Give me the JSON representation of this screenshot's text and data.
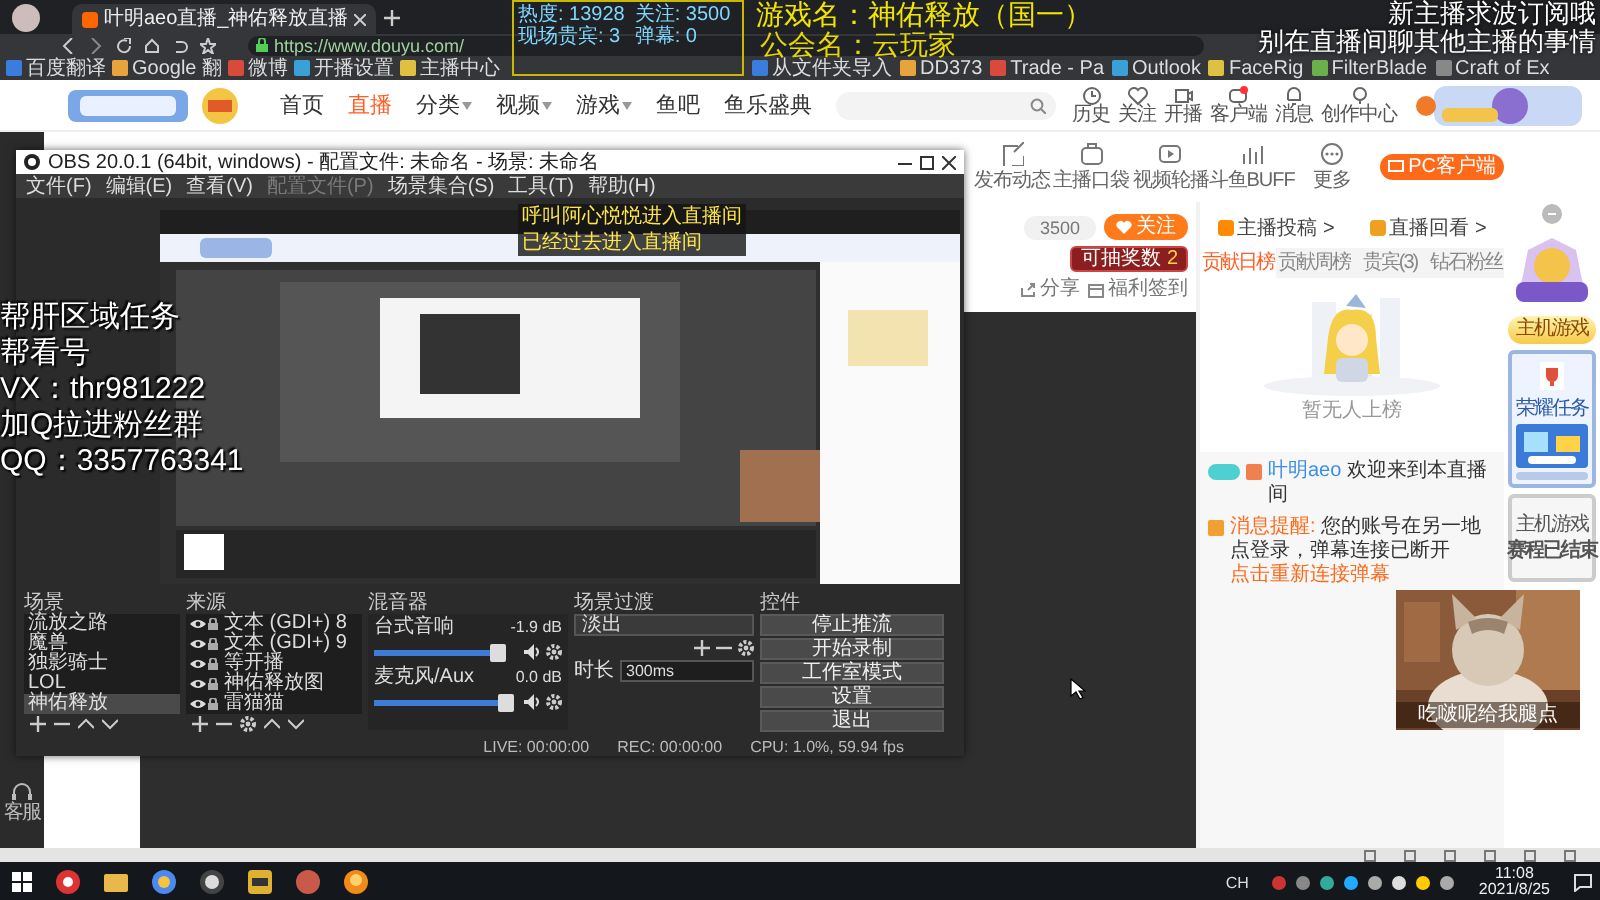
{
  "browser": {
    "tab_title": "叶明aeo直播_神佑释放直播",
    "address": "https://www.douyu.com/",
    "bookmarks_left": [
      "百度翻译",
      "Google 翻",
      "微博",
      "开播设置",
      "主播中心"
    ],
    "bookmarks_right": [
      "从文件夹导入",
      "DD373",
      "Trade - Pa",
      "Outlook",
      "FaceRig",
      "FilterBlade",
      "Craft of Ex"
    ]
  },
  "site_header": {
    "nav": [
      {
        "label": "首页",
        "selected": false,
        "dropdown": false
      },
      {
        "label": "直播",
        "selected": true,
        "dropdown": false
      },
      {
        "label": "分类",
        "selected": false,
        "dropdown": true
      },
      {
        "label": "视频",
        "selected": false,
        "dropdown": true
      },
      {
        "label": "游戏",
        "selected": false,
        "dropdown": true
      },
      {
        "label": "鱼吧",
        "selected": false,
        "dropdown": false
      },
      {
        "label": "鱼乐盛典",
        "selected": false,
        "dropdown": false
      }
    ],
    "shortcuts": [
      "历史",
      "关注",
      "开播",
      "客户端",
      "消息",
      "创作中心"
    ]
  },
  "stream_overlay": {
    "stats": [
      "热度: 13928",
      "关注: 3500",
      "现场贵宾: 3",
      "弹幕: 0"
    ],
    "entries": [
      "呼叫阿心悦悦进入直播间",
      "已经过去进入直播间"
    ],
    "game": "游戏名：神佑释放（国一）",
    "guild": "公会名：云玩家",
    "notices": [
      "新主播求波订阅哦",
      "别在直播间聊其他主播的事情"
    ],
    "promo": [
      "帮肝区域任务",
      "帮看号",
      "VX：thr981222",
      "加Q拉进粉丝群",
      "QQ：3357763341"
    ],
    "cat_caption": "吃啵呢给我腿点"
  },
  "video_toolbar": {
    "items": [
      "发布动态",
      "主播口袋",
      "视频轮播",
      "斗鱼BUFF",
      "更多"
    ],
    "client_button": "PC客户端"
  },
  "room_info": {
    "follow_count": "3500",
    "follow_button": "关注",
    "lottery_label": "可抽奖数",
    "lottery_count": "2",
    "share": "分享",
    "checkin": "福利签到"
  },
  "side_nav": {
    "service": "客服"
  },
  "rank_panel": {
    "links": [
      "主播投稿 >",
      "直播回看 >"
    ],
    "tabs": [
      {
        "label": "贡献日榜",
        "selected": true
      },
      {
        "label": "贡献周榜",
        "selected": false
      },
      {
        "label": "贵宾(3)",
        "selected": false
      },
      {
        "label": "钻石粉丝",
        "selected": false
      }
    ],
    "empty_text": "暂无人上榜"
  },
  "chat": {
    "welcome_user": "叶明aeo",
    "welcome_text": "欢迎来到本直播间",
    "notice_label": "消息提醒:",
    "notice_text": "您的账号在另一地点登录，弹幕连接已断开",
    "notice_link": "点击重新连接弹幕"
  },
  "ads": {
    "button": "主机游戏",
    "task": "荣耀任务",
    "card_title": "主机游戏",
    "card_text": "赛程已结束"
  },
  "obs": {
    "title": "OBS 20.0.1 (64bit, windows) - 配置文件: 未命名 - 场景: 未命名",
    "menu": [
      {
        "label": "文件(F)",
        "disabled": false
      },
      {
        "label": "编辑(E)",
        "disabled": false
      },
      {
        "label": "查看(V)",
        "disabled": false
      },
      {
        "label": "配置文件(P)",
        "disabled": true
      },
      {
        "label": "场景集合(S)",
        "disabled": false
      },
      {
        "label": "工具(T)",
        "disabled": false
      },
      {
        "label": "帮助(H)",
        "disabled": false
      }
    ],
    "scenes_title": "场景",
    "scenes": [
      {
        "label": "流放之路",
        "selected": false
      },
      {
        "label": "魔兽",
        "selected": false
      },
      {
        "label": "独影骑士",
        "selected": false
      },
      {
        "label": "LOL",
        "selected": false
      },
      {
        "label": "神佑释放",
        "selected": true
      }
    ],
    "sources_title": "来源",
    "sources": [
      {
        "label": "文本 (GDI+) 8",
        "visible": true
      },
      {
        "label": "文本 (GDI+) 9",
        "visible": true
      },
      {
        "label": "等开播",
        "visible": true
      },
      {
        "label": "神佑释放图",
        "visible": true
      },
      {
        "label": "雷猫猫",
        "visible": true
      }
    ],
    "mixer_title": "混音器",
    "mixer": [
      {
        "name": "台式音响",
        "reading": "-1.9 dB",
        "level": 0.9
      },
      {
        "name": "麦克风/Aux",
        "reading": "0.0 dB",
        "level": 0.97
      }
    ],
    "transition_title": "场景过渡",
    "transition": "淡出",
    "duration_label": "时长",
    "duration": "300ms",
    "controls_title": "控件",
    "controls": [
      "停止推流",
      "开始录制",
      "工作室模式",
      "设置",
      "退出"
    ],
    "status": [
      "LIVE: 00:00:00",
      "REC: 00:00:00",
      "CPU: 1.0%, 59.94 fps"
    ]
  },
  "taskbar": {
    "ime": "CH",
    "time": "11:08",
    "date": "2021/8/25"
  }
}
